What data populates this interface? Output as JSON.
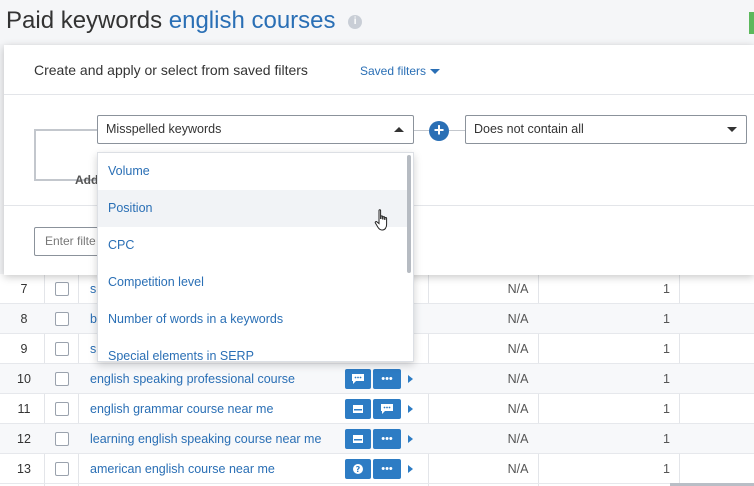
{
  "header": {
    "title_prefix": "Paid keywords",
    "title_keyword": "english courses",
    "info_icon": "info-icon"
  },
  "filter_panel": {
    "heading": "Create and apply or select from saved filters",
    "saved_filters_label": "Saved filters",
    "field_select_value": "Misspelled keywords",
    "condition_select_value": "Does not contain all",
    "add_label": "Add",
    "enter_filter_placeholder": "Enter filte",
    "dropdown_options": [
      "Volume",
      "Position",
      "CPC",
      "Competition level",
      "Number of words in a keywords",
      "Special elements in SERP"
    ],
    "hovered_option": "Position"
  },
  "table": {
    "rows": [
      {
        "num": "7",
        "keyword": "s",
        "col_na": "N/A",
        "col_val": "1"
      },
      {
        "num": "8",
        "keyword": "b",
        "col_na": "N/A",
        "col_val": "1"
      },
      {
        "num": "9",
        "keyword": "s",
        "col_na": "N/A",
        "col_val": "1"
      },
      {
        "num": "10",
        "keyword": "english speaking professional course",
        "col_na": "N/A",
        "col_val": "1",
        "buttons": [
          "comment-icon",
          "more-icon"
        ]
      },
      {
        "num": "11",
        "keyword": "english grammar course near me",
        "col_na": "N/A",
        "col_val": "1",
        "buttons": [
          "ad-icon",
          "comment-icon"
        ]
      },
      {
        "num": "12",
        "keyword": "learning english speaking course near me",
        "col_na": "N/A",
        "col_val": "1",
        "buttons": [
          "ad-icon",
          "more-icon"
        ]
      },
      {
        "num": "13",
        "keyword": "american english course near me",
        "col_na": "N/A",
        "col_val": "1",
        "buttons": [
          "question-icon",
          "more-icon"
        ]
      }
    ]
  },
  "colors": {
    "accent": "#2a6fb5",
    "button_blue": "#2d7cc4",
    "green": "#5cb85c"
  }
}
